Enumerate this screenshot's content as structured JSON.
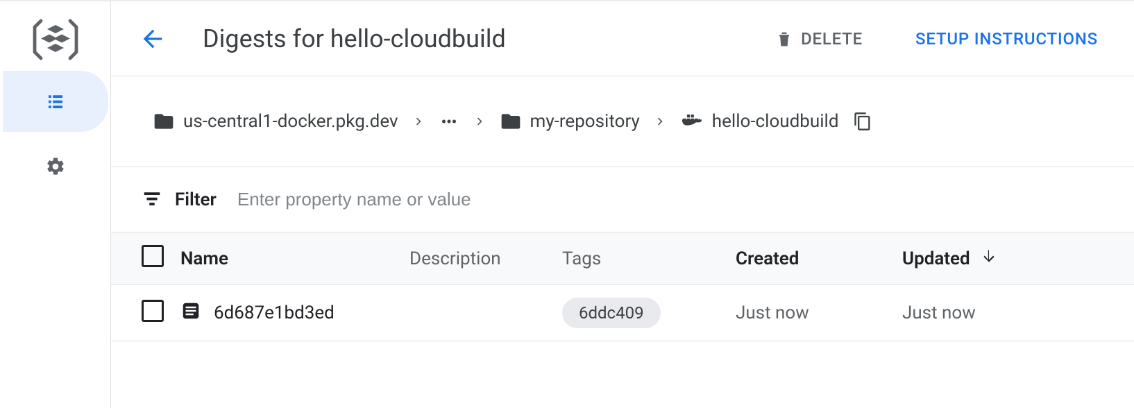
{
  "header": {
    "title": "Digests for hello-cloudbuild",
    "delete_label": "DELETE",
    "setup_label": "SETUP INSTRUCTIONS"
  },
  "breadcrumb": {
    "root": "us-central1-docker.pkg.dev",
    "ellipsis": "…",
    "repo": "my-repository",
    "pkg": "hello-cloudbuild"
  },
  "filter": {
    "label": "Filter",
    "placeholder": "Enter property name or value"
  },
  "table": {
    "headers": {
      "name": "Name",
      "description": "Description",
      "tags": "Tags",
      "created": "Created",
      "updated": "Updated"
    },
    "rows": [
      {
        "name": "6d687e1bd3ed",
        "description": "",
        "tag": "6ddc409",
        "created": "Just now",
        "updated": "Just now"
      }
    ]
  }
}
